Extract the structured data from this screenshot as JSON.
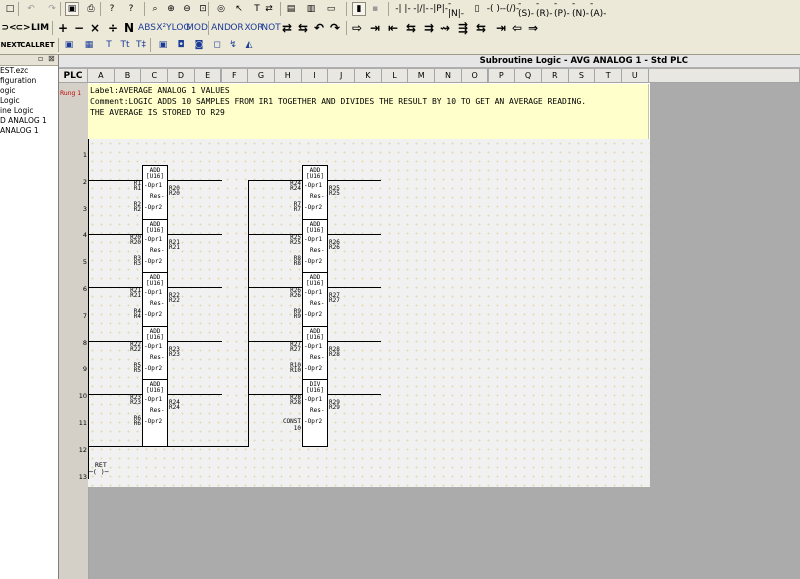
{
  "toolbar": {
    "row1": [
      {
        "name": "new-file-button",
        "icon": "□"
      },
      {
        "name": "undo-button",
        "icon": "↶",
        "style": "grey"
      },
      {
        "name": "redo-button",
        "icon": "↷",
        "style": "grey"
      },
      {
        "name": "save-button",
        "icon": "▣",
        "style": "box"
      },
      {
        "name": "print-button",
        "icon": "⎙"
      },
      {
        "name": "help-button",
        "icon": "?"
      },
      {
        "name": "context-help-button",
        "icon": "?"
      },
      {
        "name": "zoom-button",
        "icon": "⌕"
      },
      {
        "name": "zoom-in-button",
        "icon": "⊕"
      },
      {
        "name": "zoom-out-button",
        "icon": "⊖"
      },
      {
        "name": "fit-button",
        "icon": "⊡"
      },
      {
        "name": "compile-button",
        "icon": "◎"
      },
      {
        "name": "select-button",
        "icon": "↖"
      },
      {
        "name": "insert-text-button",
        "icon": "T"
      },
      {
        "name": "rung-button",
        "icon": "⇄"
      },
      {
        "name": "label-button",
        "icon": "▤"
      },
      {
        "name": "split-button",
        "icon": "▥"
      },
      {
        "name": "mode-button",
        "icon": "▭"
      },
      {
        "name": "monitor-button",
        "icon": "▮",
        "style": "box"
      },
      {
        "name": "sim-button",
        "icon": "▪",
        "style": "grey"
      },
      {
        "name": "contact-no-button",
        "icon": "-| |-"
      },
      {
        "name": "contact-nc-button",
        "icon": "-|/|-"
      },
      {
        "name": "contact-p-button",
        "icon": "-|P|-"
      },
      {
        "name": "contact-n-button",
        "icon": "-|N|-"
      },
      {
        "name": "compare-button",
        "icon": "▯"
      },
      {
        "name": "coil-button",
        "icon": "-( )-"
      },
      {
        "name": "coil-nc-button",
        "icon": "-(/)-"
      },
      {
        "name": "coil-set-button",
        "icon": "-(S)-"
      },
      {
        "name": "coil-reset-button",
        "icon": "-(R)-"
      },
      {
        "name": "coil-p-button",
        "icon": "-(P)-"
      },
      {
        "name": "coil-n-button",
        "icon": "-(N)-"
      },
      {
        "name": "coil-a-button",
        "icon": "-(A)-"
      }
    ],
    "row2_left": [
      "⊃<",
      "⊂>",
      "LIM"
    ],
    "row2": [
      "+",
      "−",
      "×",
      "÷",
      "N",
      "ABS",
      "X²Y",
      "LOG",
      "MOD",
      "AND",
      "OR",
      "XOR",
      "NOT",
      "⇄",
      "⇆",
      "↶",
      "↷",
      "⇨",
      "⇥",
      "⇤",
      "⇆",
      "⇉",
      "⇝",
      "⇶",
      "⇆",
      "⇥",
      "⇦",
      "⇒"
    ],
    "row3_left": [
      "NEXT",
      "CALL",
      "RET"
    ],
    "row3": [
      "▣",
      "▦",
      "T",
      "Tt",
      "T‡",
      "▣",
      "◘",
      "◙",
      "◻",
      "↯",
      "◭"
    ]
  },
  "tree": {
    "header_icons": [
      "▫",
      "⊠"
    ],
    "items": [
      "EST.ezc",
      "figuration",
      "ogic",
      "Logic",
      "ine Logic",
      "D ANALOG 1",
      "ANALOG 1"
    ]
  },
  "editor": {
    "title": "Subroutine Logic - AVG ANALOG 1 - Std PLC",
    "plc_label": "PLC",
    "columns": [
      "A",
      "B",
      "C",
      "D",
      "E",
      "F",
      "G",
      "H",
      "I",
      "J",
      "K",
      "L",
      "M",
      "N",
      "O",
      "P",
      "Q",
      "R",
      "S",
      "T",
      "U"
    ],
    "rung_label": "Rung 1",
    "comment_lines": [
      "Label:AVERAGE ANALOG 1 VALUES",
      "Comment:LOGIC ADDS 10 SAMPLES FROM IR1 TOGETHER AND DIVIDES THE RESULT BY 10 TO GET AN AVERAGE READING.",
      "THE AVERAGE IS STORED TO R29"
    ],
    "row_numbers": [
      "1",
      "2",
      "3",
      "4",
      "5",
      "6",
      "7",
      "8",
      "9",
      "10",
      "11",
      "12",
      "13"
    ],
    "block_type": "[U16]",
    "pins": {
      "op1": "-Opr1",
      "res": "Res-",
      "op2": "-Opr2"
    },
    "left_blocks": [
      {
        "op": "ADD",
        "opr1": "R1",
        "res": "R20",
        "opr2": "R2"
      },
      {
        "op": "ADD",
        "opr1": "R20",
        "res": "R21",
        "opr2": "R3"
      },
      {
        "op": "ADD",
        "opr1": "R21",
        "res": "R22",
        "opr2": "R4"
      },
      {
        "op": "ADD",
        "opr1": "R22",
        "res": "R23",
        "opr2": "R5"
      },
      {
        "op": "ADD",
        "opr1": "R23",
        "res": "R24",
        "opr2": "R6"
      }
    ],
    "right_blocks": [
      {
        "op": "ADD",
        "opr1": "R24",
        "res": "R25",
        "opr2": "R7"
      },
      {
        "op": "ADD",
        "opr1": "R25",
        "res": "R26",
        "opr2": "R8"
      },
      {
        "op": "ADD",
        "opr1": "R26",
        "res": "R27",
        "opr2": "R9"
      },
      {
        "op": "ADD",
        "opr1": "R27",
        "res": "R28",
        "opr2": "R10"
      },
      {
        "op": "DIV",
        "opr1": "R28",
        "res": "R29",
        "opr2": "10",
        "opr2_prefix": "CONST"
      }
    ],
    "return_label": "RET",
    "return_symbol": "─( )─"
  }
}
